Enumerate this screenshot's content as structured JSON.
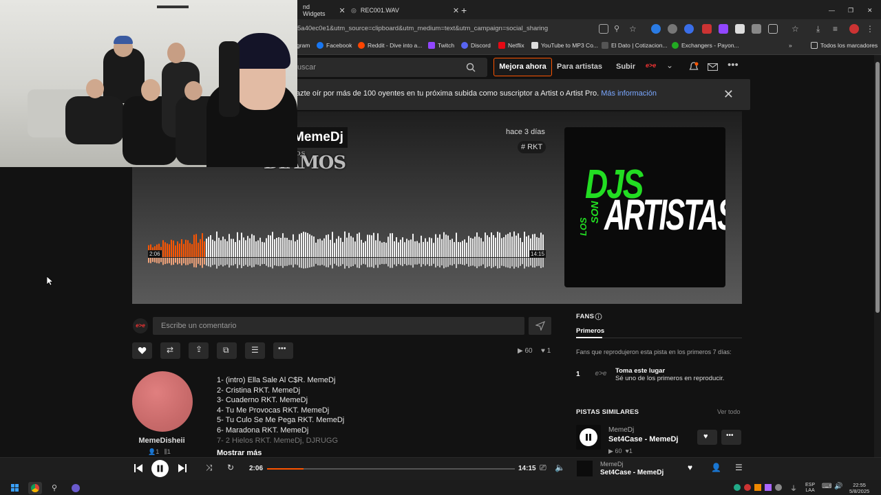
{
  "browser": {
    "tabs": [
      {
        "title": "nd Widgets"
      },
      {
        "title": "REC001.WAV"
      }
    ],
    "url": "5a40ec0e1&utm_source=clipboard&utm_medium=text&utm_campaign=social_sharing",
    "bookmarks": [
      {
        "label": "gram"
      },
      {
        "label": "Facebook"
      },
      {
        "label": "Reddit - Dive into a..."
      },
      {
        "label": "Twitch"
      },
      {
        "label": "Discord"
      },
      {
        "label": "Netflix"
      },
      {
        "label": "YouTube to MP3 Co..."
      },
      {
        "label": "El Dato | Cotizacion..."
      },
      {
        "label": "Exchangers - Payon..."
      },
      {
        "label": "Todos los marcadores"
      }
    ]
  },
  "nav": {
    "search_placeholder": "uscar",
    "upgrade": "Mejora ahora",
    "for_artists": "Para artistas",
    "upload": "Subir"
  },
  "banner": {
    "text": "azte oír por más de 100 oyentes en tu próxima subida como suscriptor a Artist o Artist Pro. ",
    "link": "Más información"
  },
  "track": {
    "artist": "MemeDj",
    "overlay_logo": "DIAMOS",
    "overlay_logo_small": "LOS",
    "time_ago": "hace 3 días",
    "tag": "# RKT",
    "current_time": "2:06",
    "duration": "14:15",
    "progress": 0.147,
    "cover_line1": "DJS",
    "cover_line2": "ARTISTAS",
    "cover_small1": "LOS",
    "cover_small2": "SON"
  },
  "comment": {
    "placeholder": "Escribe un comentario",
    "avatar_text": "e>e"
  },
  "stats": {
    "plays": "60",
    "likes": "1"
  },
  "uploader": {
    "name": "MemeDisheii",
    "followers": "1",
    "tracks": "1"
  },
  "tracklist": [
    "1- (intro) Ella Sale Al C$R. MemeDj",
    "2- Cristina RKT. MemeDj",
    "3- Cuaderno RKT. MemeDj",
    "4- Tu Me Provocas RKT. MemeDj",
    "5- Tu Culo Se Me Pega RKT. MemeDj",
    "6- Maradona RKT. MemeDj",
    "7- 2 Hielos RKT. MemeDj, DJRUGG"
  ],
  "show_more": "Mostrar más",
  "fans": {
    "title": "FANS",
    "tab": "Primeros",
    "description": "Fans que reprodujeron esta pista en los primeros 7 días:",
    "rank": "1",
    "logo": "e>e",
    "take_spot": "Toma este lugar",
    "take_spot_sub": "Sé uno de los primeros en reproducir."
  },
  "similar": {
    "title": "PISTAS SIMILARES",
    "see_all": "Ver todo",
    "user": "MemeDj",
    "track": "Set4Case - MemeDj",
    "plays": "60",
    "likes": "1"
  },
  "player": {
    "current_time": "2:06",
    "duration": "14:15",
    "progress": 0.147,
    "user": "MemeDj",
    "track": "Set4Case - MemeDj"
  },
  "taskbar": {
    "lang_line1": "ESP",
    "lang_line2": "LAA",
    "time": "22:55",
    "date": "5/8/2025"
  },
  "colors": {
    "accent": "#ff5500",
    "cover_green": "#22dd22"
  }
}
